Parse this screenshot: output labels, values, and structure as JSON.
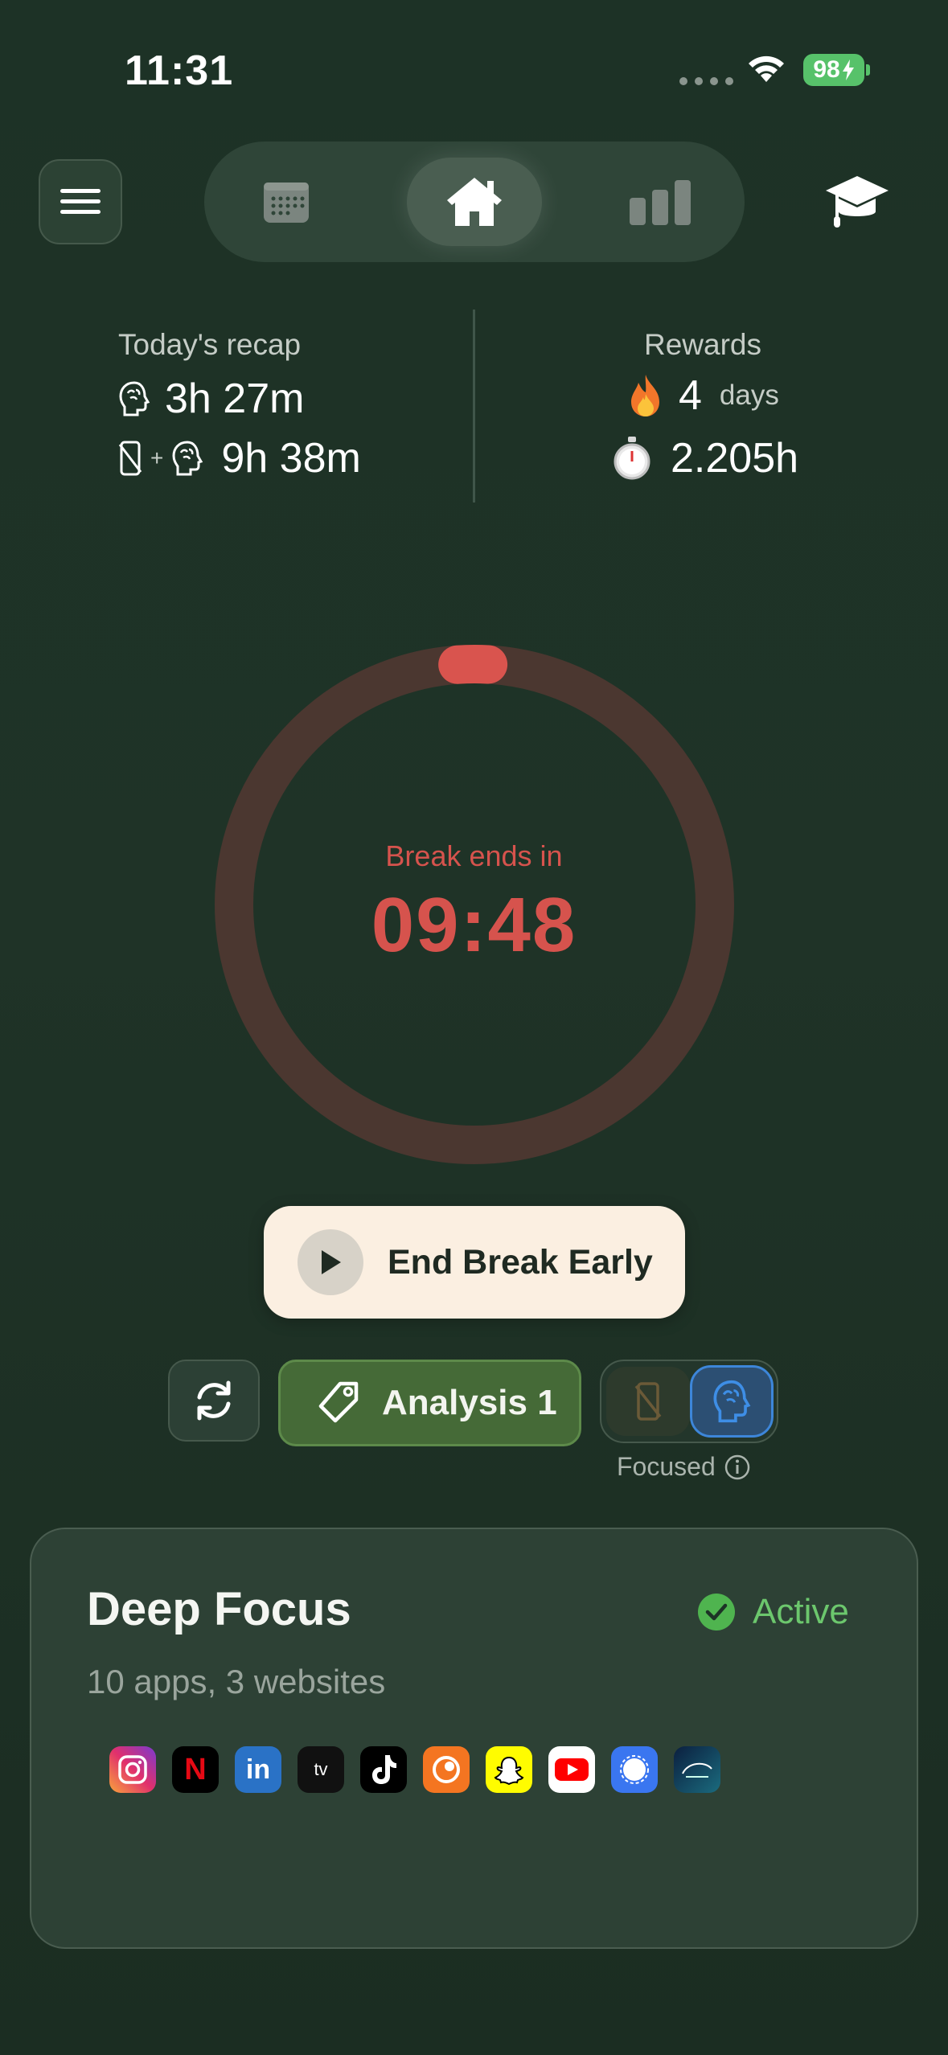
{
  "status_bar": {
    "time": "11:31",
    "battery": "98",
    "battery_color": "#57c26a"
  },
  "nav": {
    "menu_icon": "hamburger-icon",
    "tabs": [
      {
        "icon": "calendar-icon"
      },
      {
        "icon": "home-icon",
        "selected": true
      },
      {
        "icon": "bar-chart-icon"
      }
    ],
    "right_icon": "graduation-cap-icon"
  },
  "recap": {
    "title": "Today's recap",
    "focus_time": "3h 27m",
    "combined_label": "+",
    "combined_time": "9h 38m"
  },
  "rewards": {
    "title": "Rewards",
    "streak_value": "4",
    "streak_unit": "days",
    "hours": "2.205h"
  },
  "timer": {
    "label": "Break ends in",
    "value": "09:48",
    "accent": "#d6534d"
  },
  "end_break": {
    "label": "End Break Early"
  },
  "controls": {
    "tag_label": "Analysis 1",
    "mode_label": "Focused"
  },
  "card": {
    "title": "Deep Focus",
    "status": "Active",
    "subtitle": "10 apps, 3 websites",
    "apps": [
      "instagram-icon",
      "netflix-icon",
      "linkedin-icon",
      "appletv-icon",
      "tiktok-icon",
      "crunchyroll-icon",
      "snapchat-icon",
      "youtube-icon",
      "signal-icon",
      "disneyplus-icon"
    ],
    "app_glyphs": {
      "netflix": "N",
      "linkedin": "in",
      "appletv": "tv"
    }
  }
}
